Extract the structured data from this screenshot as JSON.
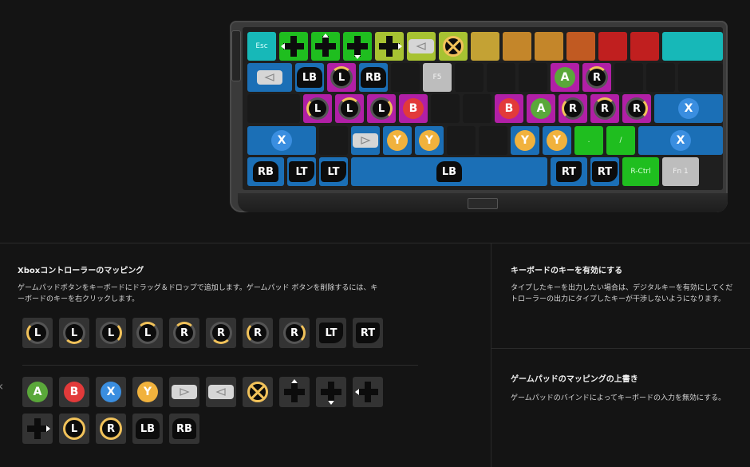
{
  "keyboard": {
    "rows": [
      [
        {
          "label": "Esc",
          "color": "#17b8b8",
          "w": 36,
          "type": "text"
        },
        {
          "color": "#1fbe1f",
          "w": 36,
          "type": "dpad",
          "arrow": "left"
        },
        {
          "color": "#1fbe1f",
          "w": 36,
          "type": "dpad",
          "arrow": "up"
        },
        {
          "color": "#1fbe1f",
          "w": 36,
          "type": "dpad",
          "arrow": "down"
        },
        {
          "color": "#a7c232",
          "w": 36,
          "type": "dpad",
          "arrow": "right"
        },
        {
          "color": "#a7c232",
          "w": 36,
          "type": "pill",
          "pill_arrow": "left"
        },
        {
          "color": "#a7c232",
          "w": 36,
          "type": "ringx"
        },
        {
          "color": "#c4a234",
          "w": 36,
          "type": "blank"
        },
        {
          "color": "#c4862a",
          "w": 36,
          "type": "blank"
        },
        {
          "color": "#c4862a",
          "w": 36,
          "type": "blank"
        },
        {
          "color": "#c15a22",
          "w": 36,
          "type": "blank"
        },
        {
          "color": "#c01f1f",
          "w": 36,
          "type": "blank"
        },
        {
          "color": "#c01f1f",
          "w": 36,
          "type": "blank"
        },
        {
          "color": "#17b8b8",
          "w": 76,
          "type": "blank"
        }
      ],
      [
        {
          "color": "#1b6fb6",
          "w": 56,
          "type": "pill",
          "pill_arrow": "left"
        },
        {
          "color": "#1b6fb6",
          "w": 36,
          "type": "bumper",
          "label": "LB"
        },
        {
          "color": "#b11fa6",
          "w": 36,
          "type": "stick",
          "label": "L",
          "hl": "hl-top"
        },
        {
          "color": "#1b6fb6",
          "w": 36,
          "type": "bumper",
          "label": "RB"
        },
        {
          "color": "#191919",
          "w": 36,
          "type": "blank"
        },
        {
          "color": "#bdbdbd",
          "w": 36,
          "type": "text",
          "label": "F5",
          "fg": "#f2f2f2"
        },
        {
          "color": "#191919",
          "w": 36,
          "type": "blank"
        },
        {
          "color": "#191919",
          "w": 36,
          "type": "blank"
        },
        {
          "color": "#191919",
          "w": 36,
          "type": "blank"
        },
        {
          "color": "#b11fa6",
          "w": 36,
          "type": "circle",
          "label": "A",
          "fill": "#5aa83a"
        },
        {
          "color": "#b11fa6",
          "w": 36,
          "type": "stick",
          "label": "R",
          "hl": "hl-top"
        },
        {
          "color": "#191919",
          "w": 36,
          "type": "blank"
        },
        {
          "color": "#191919",
          "w": 36,
          "type": "blank"
        },
        {
          "color": "#191919",
          "w": 56,
          "type": "blank"
        }
      ],
      [
        {
          "color": "#191919",
          "w": 66,
          "type": "blank"
        },
        {
          "color": "#b11fa6",
          "w": 36,
          "type": "stick",
          "label": "L",
          "hl": "hl-left"
        },
        {
          "color": "#b11fa6",
          "w": 36,
          "type": "stick",
          "label": "L",
          "hl": "hl-top"
        },
        {
          "color": "#b11fa6",
          "w": 36,
          "type": "stick",
          "label": "L",
          "hl": "hl-right"
        },
        {
          "color": "#b11fa6",
          "w": 36,
          "type": "circle",
          "label": "B",
          "fill": "#e23a3a"
        },
        {
          "color": "#191919",
          "w": 36,
          "type": "blank"
        },
        {
          "color": "#191919",
          "w": 36,
          "type": "blank"
        },
        {
          "color": "#b11fa6",
          "w": 36,
          "type": "circle",
          "label": "B",
          "fill": "#e23a3a"
        },
        {
          "color": "#b11fa6",
          "w": 36,
          "type": "circle",
          "label": "A",
          "fill": "#5aa83a"
        },
        {
          "color": "#b11fa6",
          "w": 36,
          "type": "stick",
          "label": "R",
          "hl": "hl-left"
        },
        {
          "color": "#b11fa6",
          "w": 36,
          "type": "stick",
          "label": "R",
          "hl": "hl-top"
        },
        {
          "color": "#b11fa6",
          "w": 36,
          "type": "stick",
          "label": "R",
          "hl": "hl-right"
        },
        {
          "color": "#1b6fb6",
          "w": 86,
          "type": "circle",
          "label": "X",
          "fill": "#3a8ee0"
        }
      ],
      [
        {
          "color": "#1b6fb6",
          "w": 86,
          "type": "circle",
          "label": "X",
          "fill": "#3a8ee0"
        },
        {
          "color": "#191919",
          "w": 36,
          "type": "blank"
        },
        {
          "color": "#1b6fb6",
          "w": 36,
          "type": "pill",
          "pill_arrow": "right"
        },
        {
          "color": "#1b6fb6",
          "w": 36,
          "type": "circle",
          "label": "Y",
          "fill": "#f1b23d"
        },
        {
          "color": "#1b6fb6",
          "w": 36,
          "type": "circle",
          "label": "Y",
          "fill": "#f1b23d"
        },
        {
          "color": "#191919",
          "w": 36,
          "type": "blank"
        },
        {
          "color": "#191919",
          "w": 36,
          "type": "blank"
        },
        {
          "color": "#1b6fb6",
          "w": 36,
          "type": "circle",
          "label": "Y",
          "fill": "#f1b23d"
        },
        {
          "color": "#1b6fb6",
          "w": 36,
          "type": "circle",
          "label": "Y",
          "fill": "#f1b23d"
        },
        {
          "color": "#1fbe1f",
          "w": 36,
          "type": "text",
          "label": ".",
          "fg": "#d8ffd8"
        },
        {
          "color": "#1fbe1f",
          "w": 36,
          "type": "text",
          "label": "/",
          "fg": "#d8ffd8"
        },
        {
          "color": "#1b6fb6",
          "w": 106,
          "type": "circle",
          "label": "X",
          "fill": "#3a8ee0"
        }
      ],
      [
        {
          "color": "#1b6fb6",
          "w": 46,
          "type": "bumper",
          "label": "RB"
        },
        {
          "color": "#1b6fb6",
          "w": 36,
          "type": "trigger",
          "label": "LT"
        },
        {
          "color": "#1b6fb6",
          "w": 36,
          "type": "trigger",
          "label": "LT"
        },
        {
          "color": "#1b6fb6",
          "w": 246,
          "type": "bumper",
          "label": "LB"
        },
        {
          "color": "#1b6fb6",
          "w": 46,
          "type": "trigger",
          "label": "RT"
        },
        {
          "color": "#1b6fb6",
          "w": 36,
          "type": "trigger",
          "label": "RT"
        },
        {
          "color": "#1fbe1f",
          "w": 46,
          "type": "text",
          "label": "R-Ctrl",
          "fg": "#d8ffd8"
        },
        {
          "color": "#bdbdbd",
          "w": 46,
          "type": "text",
          "label": "Fn 1",
          "fg": "#f2f2f2"
        }
      ]
    ]
  },
  "left_panel": {
    "title": "Xboxコントローラーのマッピング",
    "desc_line1": "ゲームパッドボタンをキーボードにドラッグ＆ドロップで追加します。ゲームパッド ボタンを削除するには、キ",
    "desc_line2": "ーボードのキーを右クリックします。",
    "palette_row1": [
      {
        "type": "stick",
        "label": "L",
        "hl": "hl-left"
      },
      {
        "type": "stick",
        "label": "L",
        "hl": "hl-bottom"
      },
      {
        "type": "stick",
        "label": "L",
        "hl": "hl-right"
      },
      {
        "type": "stick",
        "label": "L",
        "hl": "hl-top"
      },
      {
        "type": "stick",
        "label": "R",
        "hl": "hl-top"
      },
      {
        "type": "stick",
        "label": "R",
        "hl": "hl-bottom"
      },
      {
        "type": "stick",
        "label": "R",
        "hl": "hl-left"
      },
      {
        "type": "stick",
        "label": "R",
        "hl": "hl-right"
      },
      {
        "type": "trigger",
        "label": "LT"
      },
      {
        "type": "trigger",
        "label": "RT"
      }
    ],
    "palette_row2": [
      {
        "type": "circle",
        "label": "A",
        "fill": "#5aa83a"
      },
      {
        "type": "circle",
        "label": "B",
        "fill": "#e23a3a"
      },
      {
        "type": "circle",
        "label": "X",
        "fill": "#3a8ee0"
      },
      {
        "type": "circle",
        "label": "Y",
        "fill": "#f1b23d"
      },
      {
        "type": "pill",
        "pill_arrow": "right"
      },
      {
        "type": "pill",
        "pill_arrow": "left"
      },
      {
        "type": "ringx"
      },
      {
        "type": "dpad",
        "arrow": "up"
      },
      {
        "type": "dpad",
        "arrow": "down"
      },
      {
        "type": "dpad",
        "arrow": "left"
      }
    ],
    "palette_row3": [
      {
        "type": "dpad",
        "arrow": "right"
      },
      {
        "type": "stick",
        "label": "L",
        "hl": "hl-all"
      },
      {
        "type": "stick",
        "label": "R",
        "hl": "hl-all"
      },
      {
        "type": "bumper",
        "label": "LB"
      },
      {
        "type": "bumper",
        "label": "RB"
      }
    ]
  },
  "right_panel": {
    "section1_title": "キーボードのキーを有効にする",
    "section1_line1": "タイプしたキーを出力したい場合は、デジタルキーを有効にしてくだ",
    "section1_line2": "トローラーの出力にタイプしたキーが干渉しないようになります。",
    "section2_title": "ゲームパッドのマッピングの上書き",
    "section2_line1": "ゲームパッドのバインドによってキーボードの入力を無効にする。"
  }
}
